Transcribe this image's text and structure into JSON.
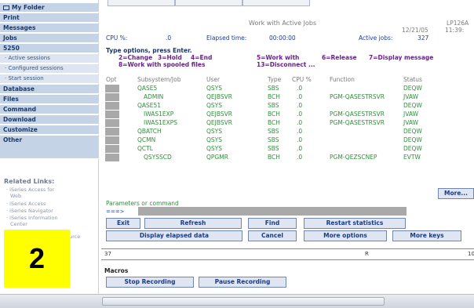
{
  "sidebar": {
    "items": [
      {
        "label": "My Folder"
      },
      {
        "label": "Print"
      },
      {
        "label": "Messages"
      },
      {
        "label": "Jobs"
      },
      {
        "label": "5250"
      }
    ],
    "sub_items": [
      {
        "label": "· Active sessions"
      },
      {
        "label": "· Configured sessions"
      },
      {
        "label": "· Start session"
      }
    ],
    "items2": [
      {
        "label": "Database"
      },
      {
        "label": "Files"
      },
      {
        "label": "Command"
      },
      {
        "label": "Download"
      },
      {
        "label": "Customize"
      },
      {
        "label": "Other"
      }
    ],
    "related_title": "Related Links:",
    "related_links": [
      "· iSeries Access for",
      "Web",
      "· iSeries Access",
      "· iSeries Navigator",
      "· iSeries Information",
      "Center",
      "urce"
    ]
  },
  "screen": {
    "title": "Work with Active Jobs",
    "system": "LP126A",
    "date": "12/21/05",
    "time": "11:39:",
    "cpu_label": "CPU %:",
    "cpu_value": ".0",
    "elapsed_label": "Elapsed time:",
    "elapsed_value": "00:00:00",
    "active_label": "Active jobs:",
    "active_value": "327",
    "type_options": "Type options, press Enter.",
    "opt_line1": [
      "2=Change",
      "3=Hold",
      "4=End",
      "5=Work with",
      "6=Release",
      "7=Display message"
    ],
    "opt_line2": [
      "8=Work with spooled files",
      "13=Disconnect ..."
    ],
    "columns": [
      "Opt",
      "Subsystem/Job",
      "User",
      "Type",
      "CPU %",
      "Function",
      "Status"
    ],
    "rows": [
      {
        "job": "QASE5",
        "user": "QSYS",
        "type": "SBS",
        "cpu": ".0",
        "function": "",
        "status": "DEQW",
        "indent": false
      },
      {
        "job": "ADMIN",
        "user": "QEJBSVR",
        "type": "BCH",
        "cpu": ".0",
        "function": "PGM-QASESTRSVR",
        "status": "JVAW",
        "indent": true
      },
      {
        "job": "QASE51",
        "user": "QSYS",
        "type": "SBS",
        "cpu": ".0",
        "function": "",
        "status": "DEQW",
        "indent": false
      },
      {
        "job": "IWAS1EXP",
        "user": "QEJBSVR",
        "type": "BCH",
        "cpu": ".0",
        "function": "PGM-QASESTRSVR",
        "status": "JVAW",
        "indent": true
      },
      {
        "job": "IWAS1EXPS",
        "user": "QEJBSVR",
        "type": "BCH",
        "cpu": ".0",
        "function": "PGM-QASESTRSVR",
        "status": "JVAW",
        "indent": true
      },
      {
        "job": "QBATCH",
        "user": "QSYS",
        "type": "SBS",
        "cpu": ".0",
        "function": "",
        "status": "DEQW",
        "indent": false
      },
      {
        "job": "QCMN",
        "user": "QSYS",
        "type": "SBS",
        "cpu": ".0",
        "function": "",
        "status": "DEQW",
        "indent": false
      },
      {
        "job": "QCTL",
        "user": "QSYS",
        "type": "SBS",
        "cpu": ".0",
        "function": "",
        "status": "DEQW",
        "indent": false
      },
      {
        "job": "QSYSSCD",
        "user": "QPGMR",
        "type": "BCH",
        "cpu": ".0",
        "function": "PGM-QEZSCNEP",
        "status": "EVTW",
        "indent": true
      }
    ],
    "more_label": "More...",
    "params_label": "Parameters or command",
    "prompt": "===>",
    "buttons_row1": [
      "Exit",
      "Refresh",
      "Find",
      "Restart statistics"
    ],
    "buttons_row2": [
      "Display elapsed data",
      "Cancel",
      "More options",
      "More keys"
    ],
    "status_line": [
      "37",
      "R",
      "10"
    ]
  },
  "macros": {
    "title": "Macros",
    "stop_label": "Stop Recording",
    "pause_label": "Pause Recording"
  },
  "callout": {
    "number": "2",
    "color": "#ffff00"
  },
  "colors": {
    "nav_bg": "#c5d3e6",
    "nav_text": "#1a3a6b",
    "heading": "#1e3d9a",
    "field": "#2e8f3a",
    "option": "#6a1f8f"
  }
}
